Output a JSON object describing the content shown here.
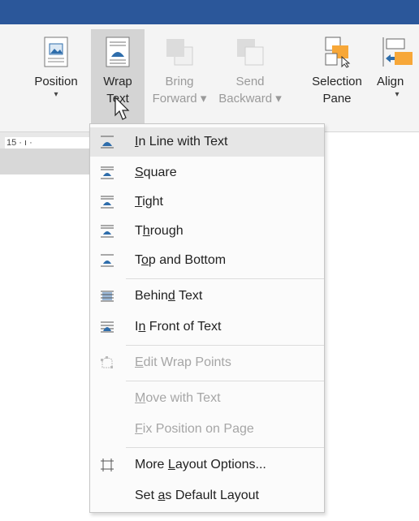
{
  "ribbon": {
    "position": "Position",
    "wrap1": "Wrap",
    "wrap2": "Text",
    "bring1": "Bring",
    "bring2": "Forward",
    "send1": "Send",
    "send2": "Backward",
    "sel1": "Selection",
    "sel2": "Pane",
    "align": "Align"
  },
  "ruler": {
    "scale": "15 · ı ·"
  },
  "menu": {
    "items": [
      {
        "label": "In Line with Text",
        "key": "I"
      },
      {
        "label": "Square",
        "key": "S"
      },
      {
        "label": "Tight",
        "key": "T"
      },
      {
        "label": "Through",
        "key": "h"
      },
      {
        "label": "Top and Bottom",
        "key": "o"
      },
      {
        "label": "Behind Text",
        "key": "d"
      },
      {
        "label": "In Front of Text",
        "key": "n"
      },
      {
        "label": "Edit Wrap Points",
        "key": "E"
      },
      {
        "label": "Move with Text",
        "key": "M"
      },
      {
        "label": "Fix Position on Page",
        "key": "F"
      },
      {
        "label": "More Layout Options...",
        "key": "L"
      },
      {
        "label": "Set as Default Layout",
        "key": "a"
      }
    ]
  },
  "colors": {
    "titlebar": "#2b579a",
    "accent_orange": "#f7a738",
    "icon_blue": "#2e6dab"
  }
}
